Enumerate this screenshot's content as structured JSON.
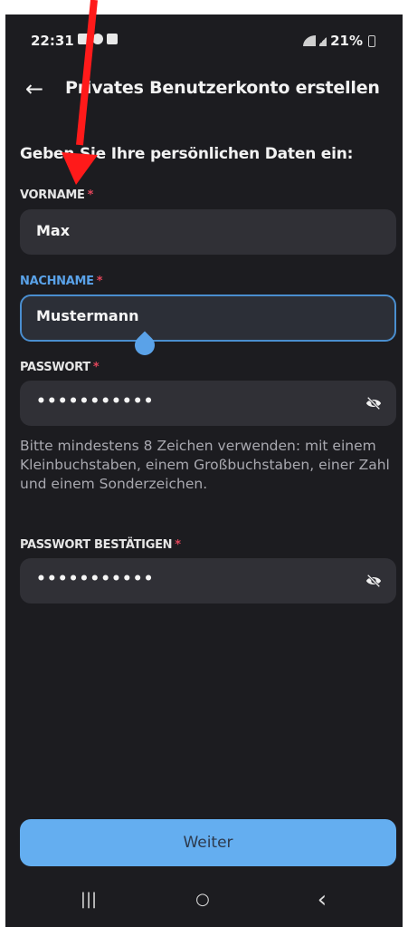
{
  "status_bar": {
    "time": "22:31",
    "battery": "21%"
  },
  "app_bar": {
    "back_icon": "arrow-left-icon",
    "title": "Privates Benutzerkonto erstellen"
  },
  "form": {
    "subtitle": "Geben Sie Ihre persönlichen Daten ein:",
    "required_marker": "*",
    "vorname": {
      "label": "VORNAME",
      "value": "Max"
    },
    "nachname": {
      "label": "NACHNAME",
      "value": "Mustermann"
    },
    "passwort": {
      "label": "PASSWORT",
      "value": "•••••••••••"
    },
    "hint": "Bitte mindestens 8 Zeichen verwenden: mit einem Kleinbuchstaben, einem Großbuchstaben, einer Zahl und einem Sonderzeichen.",
    "passwort_bestaetigen": {
      "label": "PASSWORT BESTÄTIGEN",
      "value": "•••••••••••"
    }
  },
  "actions": {
    "weiter_label": "Weiter"
  },
  "nav": {
    "recent": "|||",
    "home": "○",
    "back": "‹"
  },
  "colors": {
    "background": "#1c1c20",
    "field": "#303036",
    "accent": "#64aef0",
    "required": "#e0455a",
    "annotation": "#ff1a1a"
  }
}
